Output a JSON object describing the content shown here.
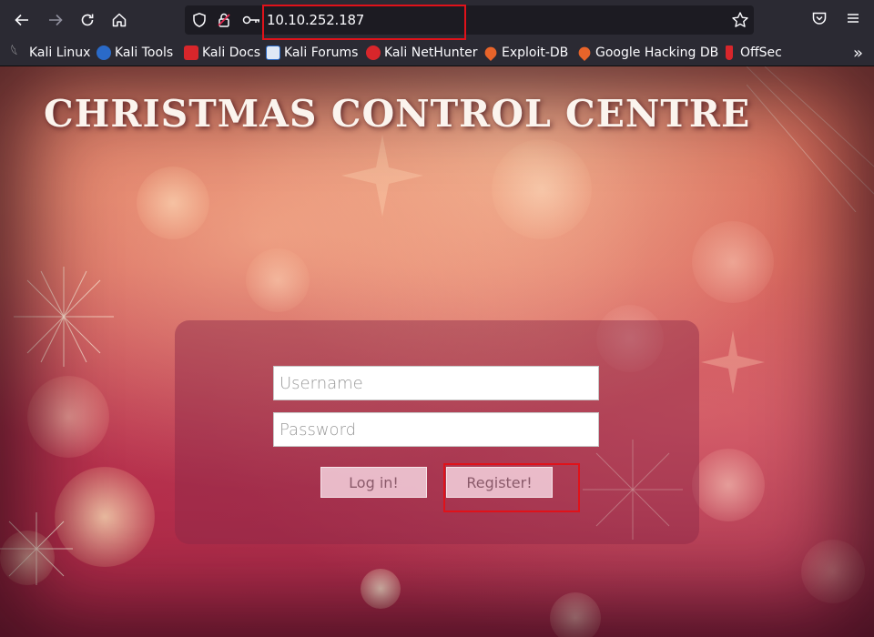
{
  "browser": {
    "url": "10.10.252.187",
    "bookmarks": [
      {
        "label": "Kali Linux",
        "icon": "kali-dragon-icon",
        "color": "#e9e9e9"
      },
      {
        "label": "Kali Tools",
        "icon": "kali-tools-icon",
        "color": "#2a6ac8"
      },
      {
        "label": "Kali Docs",
        "icon": "kali-docs-icon",
        "color": "#d8262b"
      },
      {
        "label": "Kali Forums",
        "icon": "kali-forums-icon",
        "color": "#2a6ac8"
      },
      {
        "label": "Kali NetHunter",
        "icon": "nethunter-icon",
        "color": "#d8262b"
      },
      {
        "label": "Exploit-DB",
        "icon": "exploit-db-icon",
        "color": "#e8642a"
      },
      {
        "label": "Google Hacking DB",
        "icon": "ghdb-icon",
        "color": "#e8642a"
      },
      {
        "label": "OffSec",
        "icon": "offsec-icon",
        "color": "#d8262b"
      }
    ]
  },
  "page": {
    "title": "CHRISTMAS CONTROL CENTRE",
    "login": {
      "username_placeholder": "Username",
      "password_placeholder": "Password",
      "login_label": "Log in!",
      "register_label": "Register!"
    }
  },
  "colors": {
    "highlight": "#e0121a",
    "chrome": "#2b2a33"
  }
}
